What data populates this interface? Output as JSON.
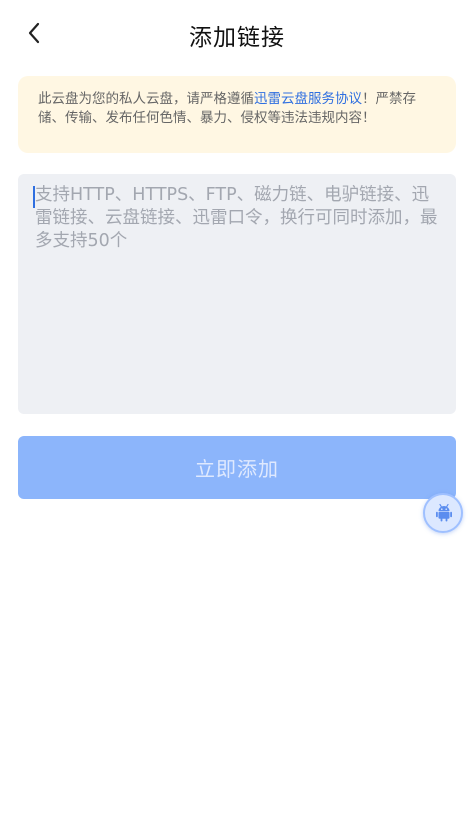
{
  "header": {
    "title": "添加链接",
    "back_icon": "chevron-left-icon"
  },
  "notice": {
    "text_before": "此云盘为您的私人云盘，请严格遵循",
    "link_text": "迅雷云盘服务协议",
    "text_after": "！严禁存储、传输、发布任何色情、暴力、侵权等违法违规内容！",
    "bg_color": "#fff7e3",
    "link_color": "#2f6fe0"
  },
  "link_input": {
    "value": "",
    "placeholder": "支持HTTP、HTTPS、FTP、磁力链、电驴链接、迅雷链接、云盘链接、迅雷口令，换行可同时添加，最多支持50个"
  },
  "submit": {
    "label": "立即添加",
    "color": "#8cb5fb"
  },
  "float_button": {
    "icon": "android-icon"
  }
}
